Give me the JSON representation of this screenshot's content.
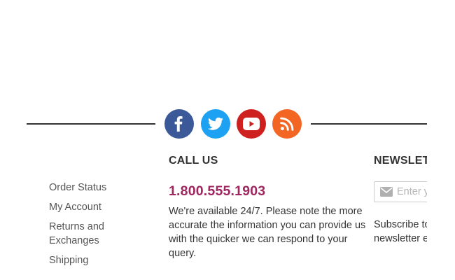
{
  "social": {
    "facebook": {
      "color": "#3b5998",
      "icon": "facebook-icon"
    },
    "twitter": {
      "color": "#1da1f2",
      "icon": "twitter-icon"
    },
    "youtube": {
      "color": "#cd201f",
      "icon": "youtube-icon"
    },
    "rss": {
      "color": "#f26522",
      "icon": "rss-icon"
    }
  },
  "links": [
    "Order Status",
    "My Account",
    "Returns and Exchanges",
    "Shipping"
  ],
  "call_us": {
    "heading": "CALL US",
    "phone": "1.800.555.1903",
    "availability": "We're available 24/7. Please note the more accurate the information you can provide us with the quicker we can respond to your query."
  },
  "newsletter": {
    "heading": "NEWSLETTER",
    "email_placeholder": "Enter your email",
    "subscribe_text": "Subscribe to receive our newsletter every two weeks."
  }
}
